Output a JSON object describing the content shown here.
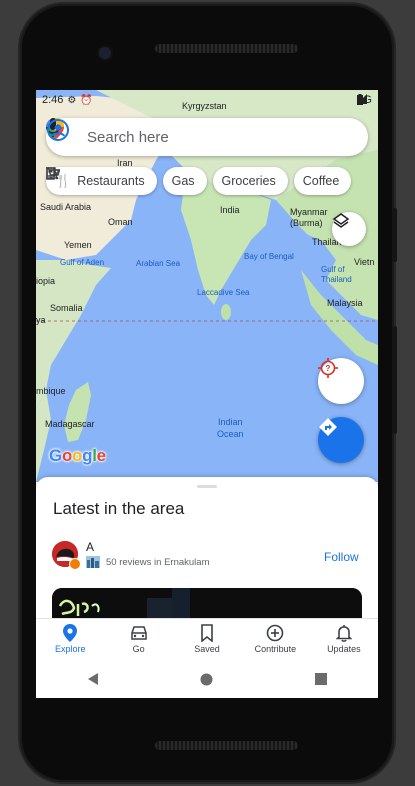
{
  "status_bar": {
    "time": "2:46",
    "network": "3G"
  },
  "search": {
    "placeholder": "Search here"
  },
  "chips": [
    {
      "label": "Restaurants",
      "icon": "fork-knife-icon"
    },
    {
      "label": "Gas",
      "icon": "gas-pump-icon"
    },
    {
      "label": "Groceries",
      "icon": "cart-icon"
    },
    {
      "label": "Coffee",
      "icon": "coffee-cup-icon"
    }
  ],
  "map": {
    "labels": {
      "kyrgyzstan": "Kyrgyzstan",
      "iran": "Iran",
      "saudi": "Saudi Arabia",
      "oman": "Oman",
      "india": "India",
      "myanmar": "Myanmar\n(Burma)",
      "thailand": "Thailan",
      "yemen": "Yemen",
      "gulf_aden": "Gulf of Aden",
      "arabian_sea": "Arabian Sea",
      "bay_bengal": "Bay of Bengal",
      "gulf_thailand": "Gulf of\nThailand",
      "vietnam": "Vietn",
      "ethiopia": "iopia",
      "somalia": "Somalia",
      "laccadive": "Laccadive Sea",
      "malaysia": "Malaysia",
      "kenya": "ya",
      "mozambique": "mbique",
      "madagascar": "Madagascar",
      "indian_ocean": "Indian\nOcean"
    },
    "logo": "Google"
  },
  "sheet": {
    "title": "Latest in the area",
    "author_name": "A",
    "author_meta": "50 reviews in Ernakulam",
    "follow_label": "Follow"
  },
  "bottom_nav": [
    {
      "label": "Explore",
      "icon": "explore-pin-icon",
      "active": true
    },
    {
      "label": "Go",
      "icon": "car-icon",
      "active": false
    },
    {
      "label": "Saved",
      "icon": "bookmark-icon",
      "active": false
    },
    {
      "label": "Contribute",
      "icon": "plus-circle-icon",
      "active": false
    },
    {
      "label": "Updates",
      "icon": "bell-icon",
      "active": false
    }
  ],
  "colors": {
    "accent": "#1a73e8",
    "water": "#8ab4f8",
    "land": "#c8e6c9",
    "desert": "#f1ebd9",
    "locate_red": "#d93025"
  }
}
